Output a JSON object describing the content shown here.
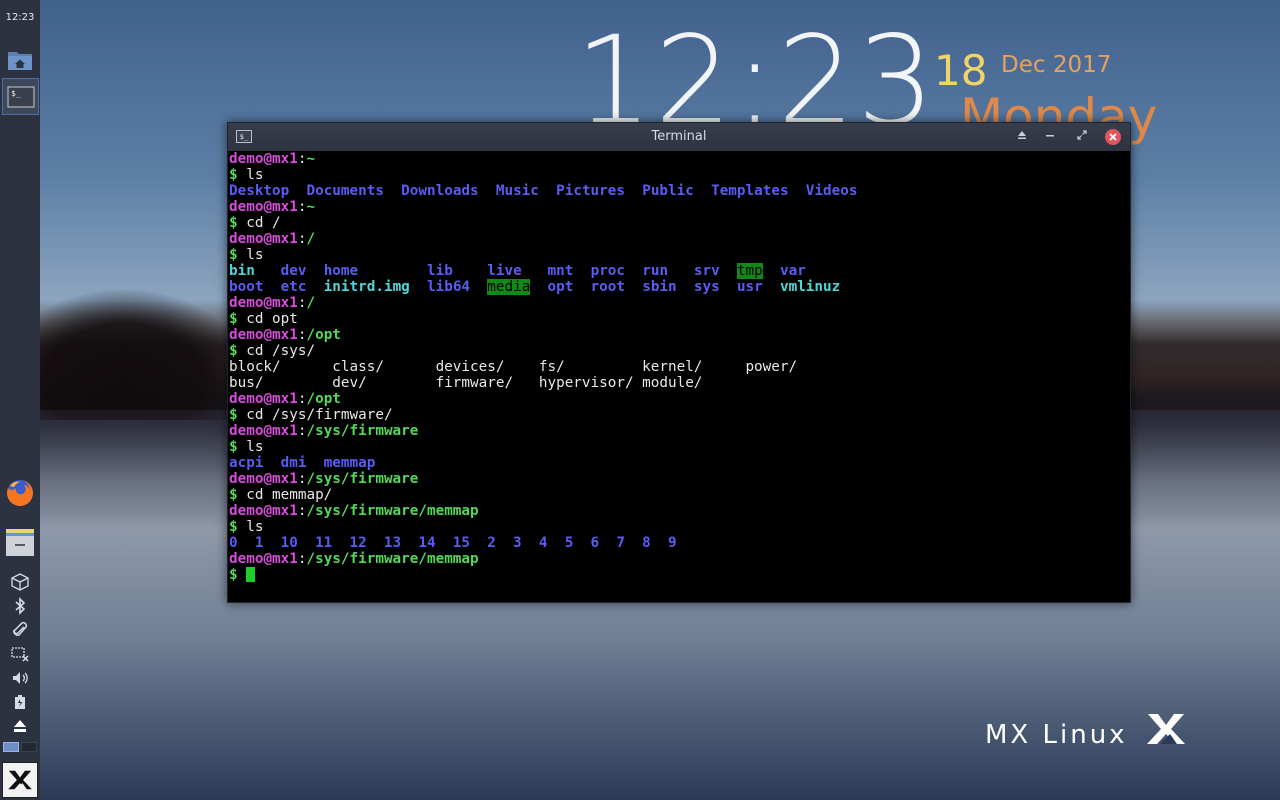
{
  "desktop": {
    "conky": {
      "time": "12:23",
      "day": "18",
      "month_year": "Dec 2017",
      "weekday": "Monday"
    },
    "logo_text": "MX Linux"
  },
  "panel": {
    "clock": "12:23",
    "icons": [
      "home-folder-icon",
      "terminal-icon",
      "firefox-icon",
      "file-manager-icon",
      "package-icon",
      "bluetooth-icon",
      "clipboard-icon",
      "screenshot-icon",
      "volume-icon",
      "battery-icon",
      "eject-icon",
      "mx-menu-icon"
    ]
  },
  "terminal": {
    "title": "Terminal",
    "title_icon": "$_",
    "prompt_user": "demo",
    "prompt_host": "@mx1",
    "lines": [
      {
        "type": "prompt",
        "path": "~"
      },
      {
        "type": "cmd",
        "text": "ls"
      },
      {
        "type": "out",
        "items": [
          {
            "t": "Desktop",
            "c": "dir"
          },
          {
            "t": "  ",
            "c": "plain"
          },
          {
            "t": "Documents",
            "c": "dir"
          },
          {
            "t": "  ",
            "c": "plain"
          },
          {
            "t": "Downloads",
            "c": "dir"
          },
          {
            "t": "  ",
            "c": "plain"
          },
          {
            "t": "Music",
            "c": "dir"
          },
          {
            "t": "  ",
            "c": "plain"
          },
          {
            "t": "Pictures",
            "c": "dir"
          },
          {
            "t": "  ",
            "c": "plain"
          },
          {
            "t": "Public",
            "c": "dir"
          },
          {
            "t": "  ",
            "c": "plain"
          },
          {
            "t": "Templates",
            "c": "dir"
          },
          {
            "t": "  ",
            "c": "plain"
          },
          {
            "t": "Videos",
            "c": "dir"
          }
        ]
      },
      {
        "type": "prompt",
        "path": "~"
      },
      {
        "type": "cmd",
        "text": "cd /"
      },
      {
        "type": "prompt",
        "path": "/"
      },
      {
        "type": "cmd",
        "text": "ls"
      },
      {
        "type": "out",
        "items": [
          {
            "t": "bin",
            "c": "link"
          },
          {
            "t": "   ",
            "c": "plain"
          },
          {
            "t": "dev",
            "c": "dir"
          },
          {
            "t": "  ",
            "c": "plain"
          },
          {
            "t": "home",
            "c": "dir"
          },
          {
            "t": "        ",
            "c": "plain"
          },
          {
            "t": "lib",
            "c": "dir"
          },
          {
            "t": "    ",
            "c": "plain"
          },
          {
            "t": "live",
            "c": "dir"
          },
          {
            "t": "   ",
            "c": "plain"
          },
          {
            "t": "mnt",
            "c": "dir"
          },
          {
            "t": "  ",
            "c": "plain"
          },
          {
            "t": "proc",
            "c": "dir"
          },
          {
            "t": "  ",
            "c": "plain"
          },
          {
            "t": "run",
            "c": "dir"
          },
          {
            "t": "   ",
            "c": "plain"
          },
          {
            "t": "srv",
            "c": "dir"
          },
          {
            "t": "  ",
            "c": "plain"
          },
          {
            "t": "tmp",
            "c": "stickydir"
          },
          {
            "t": "  ",
            "c": "plain"
          },
          {
            "t": "var",
            "c": "dir"
          }
        ]
      },
      {
        "type": "out",
        "items": [
          {
            "t": "boot",
            "c": "dir"
          },
          {
            "t": "  ",
            "c": "plain"
          },
          {
            "t": "etc",
            "c": "dir"
          },
          {
            "t": "  ",
            "c": "plain"
          },
          {
            "t": "initrd.img",
            "c": "link"
          },
          {
            "t": "  ",
            "c": "plain"
          },
          {
            "t": "lib64",
            "c": "dir"
          },
          {
            "t": "  ",
            "c": "plain"
          },
          {
            "t": "media",
            "c": "stickydir"
          },
          {
            "t": "  ",
            "c": "plain"
          },
          {
            "t": "opt",
            "c": "dir"
          },
          {
            "t": "  ",
            "c": "plain"
          },
          {
            "t": "root",
            "c": "dir"
          },
          {
            "t": "  ",
            "c": "plain"
          },
          {
            "t": "sbin",
            "c": "dir"
          },
          {
            "t": "  ",
            "c": "plain"
          },
          {
            "t": "sys",
            "c": "dir"
          },
          {
            "t": "  ",
            "c": "plain"
          },
          {
            "t": "usr",
            "c": "dir"
          },
          {
            "t": "  ",
            "c": "plain"
          },
          {
            "t": "vmlinuz",
            "c": "link"
          }
        ]
      },
      {
        "type": "prompt",
        "path": "/"
      },
      {
        "type": "cmd",
        "text": "cd opt"
      },
      {
        "type": "prompt",
        "path": "/opt"
      },
      {
        "type": "cmd",
        "text": "cd /sys/"
      },
      {
        "type": "out",
        "items": [
          {
            "t": "block/      class/      devices/    fs/         kernel/     power/",
            "c": "plain"
          }
        ]
      },
      {
        "type": "out",
        "items": [
          {
            "t": "bus/        dev/        firmware/   hypervisor/ module/",
            "c": "plain"
          }
        ]
      },
      {
        "type": "prompt",
        "path": "/opt"
      },
      {
        "type": "cmd",
        "text": "cd /sys/firmware/"
      },
      {
        "type": "prompt",
        "path": "/sys/firmware"
      },
      {
        "type": "cmd",
        "text": "ls"
      },
      {
        "type": "out",
        "items": [
          {
            "t": "acpi",
            "c": "dir"
          },
          {
            "t": "  ",
            "c": "plain"
          },
          {
            "t": "dmi",
            "c": "dir"
          },
          {
            "t": "  ",
            "c": "plain"
          },
          {
            "t": "memmap",
            "c": "dir"
          }
        ]
      },
      {
        "type": "prompt",
        "path": "/sys/firmware"
      },
      {
        "type": "cmd",
        "text": "cd memmap/"
      },
      {
        "type": "prompt",
        "path": "/sys/firmware/memmap"
      },
      {
        "type": "cmd",
        "text": "ls"
      },
      {
        "type": "out",
        "items": [
          {
            "t": "0  1  10  11  12  13  14  15  2  3  4  5  6  7  8  9",
            "c": "dir"
          }
        ]
      },
      {
        "type": "prompt",
        "path": "/sys/firmware/memmap"
      },
      {
        "type": "cursor"
      }
    ]
  },
  "colors": {
    "prompt_user": "#d44fd7",
    "prompt_path": "#54d85a",
    "dir": "#5a5cf2",
    "link": "#4fd7d7",
    "sticky_bg": "#0e8a17",
    "cursor": "#1ecf2a",
    "panel_bg": "#2c3240",
    "close_button": "#e0565f"
  }
}
